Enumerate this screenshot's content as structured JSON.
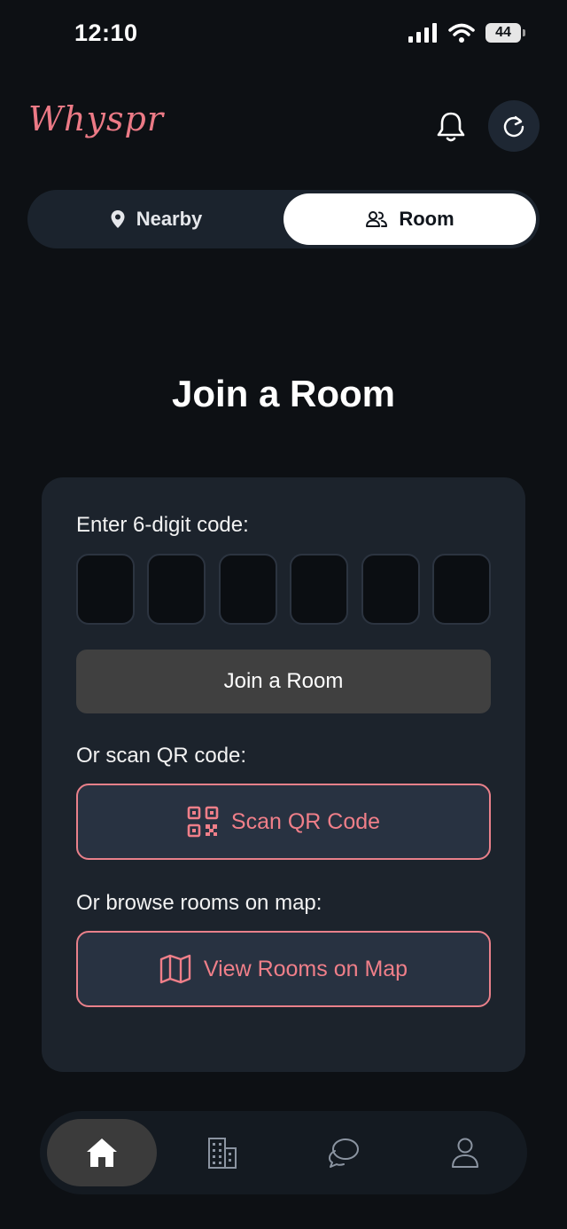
{
  "status_bar": {
    "time": "12:10",
    "battery": "44"
  },
  "header": {
    "logo": "Whyspr",
    "icons": [
      "bell-icon",
      "refresh-icon"
    ]
  },
  "segment": {
    "nearby_label": "Nearby",
    "room_label": "Room",
    "selected": "Room"
  },
  "main": {
    "title": "Join a Room",
    "code_label": "Enter 6-digit code:",
    "code_digits": [
      "",
      "",
      "",
      "",
      "",
      ""
    ],
    "join_button": "Join a Room",
    "qr_label": "Or scan QR code:",
    "qr_button": "Scan QR Code",
    "map_label": "Or browse rooms on map:",
    "map_button": "View Rooms on Map"
  },
  "bottom_nav": {
    "items": [
      "home-icon",
      "building-icon",
      "chat-icon",
      "profile-icon"
    ],
    "active": "home-icon"
  },
  "colors": {
    "background": "#0d1014",
    "accent": "#ec7a86",
    "card": "#1c232c"
  }
}
